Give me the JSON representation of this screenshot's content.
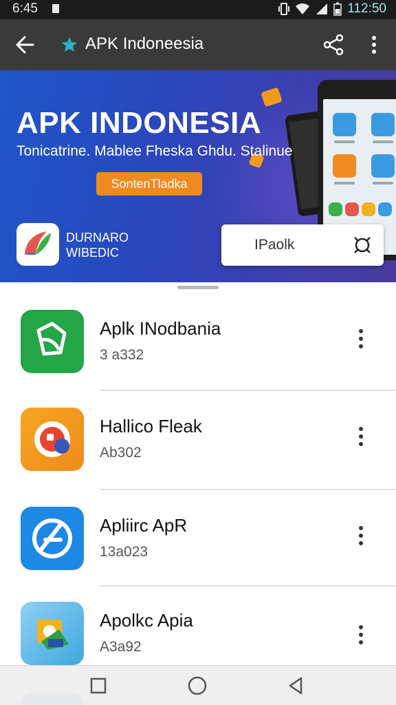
{
  "status_bar": {
    "time": "6:45",
    "clock": "112:50"
  },
  "app_bar": {
    "title": "APK Indoneesia",
    "back_icon": "arrow-left-icon",
    "share_icon": "share-icon",
    "more_icon": "more-vertical-icon"
  },
  "banner": {
    "title": "APK INDONESIA",
    "subtitle": "Tonicatrine. Mablee Fheska Ghdu. Stalinue",
    "cta_label": "SontenTladka",
    "brand_line1": "DURNARO",
    "brand_line2": "WIBEDIC",
    "search_text": "IPaolk"
  },
  "apps": [
    {
      "name": "Aplk INodbania",
      "meta": "3 a332",
      "icon": "green-app-icon"
    },
    {
      "name": "Hallico Fleak",
      "meta": "Ab302",
      "icon": "orange-app-icon"
    },
    {
      "name": "Apliirc ApR",
      "meta": "13a023",
      "icon": "blue-app-icon"
    },
    {
      "name": "Apolkc Apia",
      "meta": "A3a92",
      "icon": "lightblue-app-icon"
    }
  ],
  "nav": {
    "recents_icon": "square-recents-icon",
    "home_icon": "circle-home-icon",
    "back_icon": "triangle-back-icon"
  }
}
